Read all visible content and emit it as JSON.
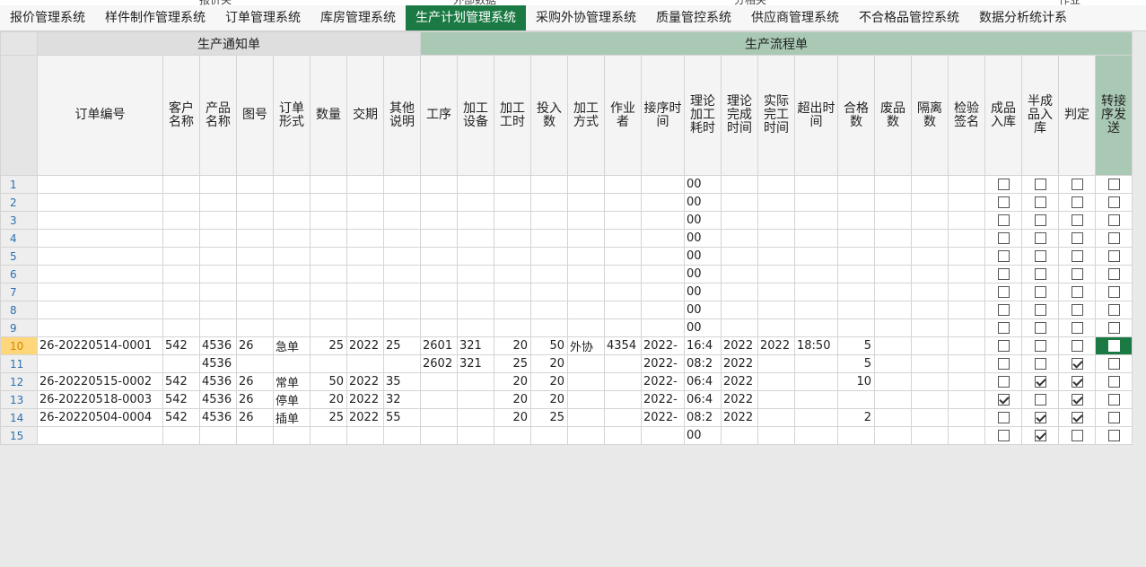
{
  "topstrip": [
    "报价关",
    "外部数据",
    "分相关",
    "作业"
  ],
  "menu": [
    {
      "label": "报价管理系统",
      "active": false
    },
    {
      "label": "样件制作管理系统",
      "active": false
    },
    {
      "label": "订单管理系统",
      "active": false
    },
    {
      "label": "库房管理系统",
      "active": false
    },
    {
      "label": "生产计划管理系统",
      "active": true
    },
    {
      "label": "采购外协管理系统",
      "active": false
    },
    {
      "label": "质量管控系统",
      "active": false
    },
    {
      "label": "供应商管理系统",
      "active": false
    },
    {
      "label": "不合格品管控系统",
      "active": false
    },
    {
      "label": "数据分析统计系",
      "active": false
    }
  ],
  "groups": {
    "notice": "生产通知单",
    "flow": "生产流程单"
  },
  "columns": [
    "订单编号",
    "客户名称",
    "产品名称",
    "图号",
    "订单形式",
    "数量",
    "交期",
    "其他说明",
    "工序",
    "加工设备",
    "加工工时",
    "投入数",
    "加工方式",
    "作业者",
    "接序时间",
    "理论加工耗时",
    "理论完成时间",
    "实际完工时间",
    "超出时间",
    "合格数",
    "废品数",
    "隔离数",
    "检验签名",
    "成品入库",
    "半成品入库",
    "判定",
    "转接序发送"
  ],
  "rows": [
    {
      "n": "1",
      "f": [
        "",
        "",
        "",
        "",
        "",
        "",
        "",
        "",
        "",
        "",
        "",
        "",
        "",
        "",
        "",
        "00",
        "",
        "",
        "",
        "",
        "",
        "",
        ""
      ],
      "cb": [
        false,
        false,
        false,
        false
      ]
    },
    {
      "n": "2",
      "f": [
        "",
        "",
        "",
        "",
        "",
        "",
        "",
        "",
        "",
        "",
        "",
        "",
        "",
        "",
        "",
        "00",
        "",
        "",
        "",
        "",
        "",
        "",
        ""
      ],
      "cb": [
        false,
        false,
        false,
        false
      ]
    },
    {
      "n": "3",
      "f": [
        "",
        "",
        "",
        "",
        "",
        "",
        "",
        "",
        "",
        "",
        "",
        "",
        "",
        "",
        "",
        "00",
        "",
        "",
        "",
        "",
        "",
        "",
        ""
      ],
      "cb": [
        false,
        false,
        false,
        false
      ]
    },
    {
      "n": "4",
      "f": [
        "",
        "",
        "",
        "",
        "",
        "",
        "",
        "",
        "",
        "",
        "",
        "",
        "",
        "",
        "",
        "00",
        "",
        "",
        "",
        "",
        "",
        "",
        ""
      ],
      "cb": [
        false,
        false,
        false,
        false
      ]
    },
    {
      "n": "5",
      "f": [
        "",
        "",
        "",
        "",
        "",
        "",
        "",
        "",
        "",
        "",
        "",
        "",
        "",
        "",
        "",
        "00",
        "",
        "",
        "",
        "",
        "",
        "",
        ""
      ],
      "cb": [
        false,
        false,
        false,
        false
      ]
    },
    {
      "n": "6",
      "f": [
        "",
        "",
        "",
        "",
        "",
        "",
        "",
        "",
        "",
        "",
        "",
        "",
        "",
        "",
        "",
        "00",
        "",
        "",
        "",
        "",
        "",
        "",
        ""
      ],
      "cb": [
        false,
        false,
        false,
        false
      ]
    },
    {
      "n": "7",
      "f": [
        "",
        "",
        "",
        "",
        "",
        "",
        "",
        "",
        "",
        "",
        "",
        "",
        "",
        "",
        "",
        "00",
        "",
        "",
        "",
        "",
        "",
        "",
        ""
      ],
      "cb": [
        false,
        false,
        false,
        false
      ]
    },
    {
      "n": "8",
      "f": [
        "",
        "",
        "",
        "",
        "",
        "",
        "",
        "",
        "",
        "",
        "",
        "",
        "",
        "",
        "",
        "00",
        "",
        "",
        "",
        "",
        "",
        "",
        ""
      ],
      "cb": [
        false,
        false,
        false,
        false
      ]
    },
    {
      "n": "9",
      "f": [
        "",
        "",
        "",
        "",
        "",
        "",
        "",
        "",
        "",
        "",
        "",
        "",
        "",
        "",
        "",
        "00",
        "",
        "",
        "",
        "",
        "",
        "",
        ""
      ],
      "cb": [
        false,
        false,
        false,
        false
      ]
    },
    {
      "n": "10",
      "sel": true,
      "f": [
        "26-20220514-0001",
        "542",
        "4536",
        "26",
        "急单",
        "25",
        "2022",
        "25",
        "2601",
        "321",
        "20",
        "50",
        "外协",
        "4354",
        "2022-",
        "16:4",
        "2022",
        "2022",
        "18:50",
        "5",
        "",
        "",
        ""
      ],
      "cb": [
        false,
        false,
        false,
        true
      ]
    },
    {
      "n": "11",
      "f": [
        "",
        "",
        "4536",
        "",
        "",
        "",
        "",
        "",
        "2602",
        "321",
        "25",
        "20",
        "",
        "",
        "2022-",
        "08:2",
        "2022",
        "",
        "",
        "5",
        "",
        "",
        ""
      ],
      "cb": [
        false,
        false,
        true,
        false
      ]
    },
    {
      "n": "12",
      "f": [
        "26-20220515-0002",
        "542",
        "4536",
        "26",
        "常单",
        "50",
        "2022",
        "35",
        "",
        "",
        "20",
        "20",
        "",
        "",
        "2022-",
        "06:4",
        "2022",
        "",
        "",
        "10",
        "",
        "",
        ""
      ],
      "cb": [
        false,
        true,
        true,
        false
      ]
    },
    {
      "n": "13",
      "f": [
        "26-20220518-0003",
        "542",
        "4536",
        "26",
        "停单",
        "20",
        "2022",
        "32",
        "",
        "",
        "20",
        "20",
        "",
        "",
        "2022-",
        "06:4",
        "2022",
        "",
        "",
        "",
        "",
        "",
        ""
      ],
      "cb": [
        true,
        false,
        true,
        false
      ]
    },
    {
      "n": "14",
      "f": [
        "26-20220504-0004",
        "542",
        "4536",
        "26",
        "插单",
        "25",
        "2022",
        "55",
        "",
        "",
        "20",
        "25",
        "",
        "",
        "2022-",
        "08:2",
        "2022",
        "",
        "",
        "2",
        "",
        "",
        ""
      ],
      "cb": [
        false,
        true,
        true,
        false
      ]
    },
    {
      "n": "15",
      "f": [
        "",
        "",
        "",
        "",
        "",
        "",
        "",
        "",
        "",
        "",
        "",
        "",
        "",
        "",
        "",
        "00",
        "",
        "",
        "",
        "",
        "",
        "",
        ""
      ],
      "cb": [
        false,
        true,
        false,
        false
      ]
    }
  ]
}
